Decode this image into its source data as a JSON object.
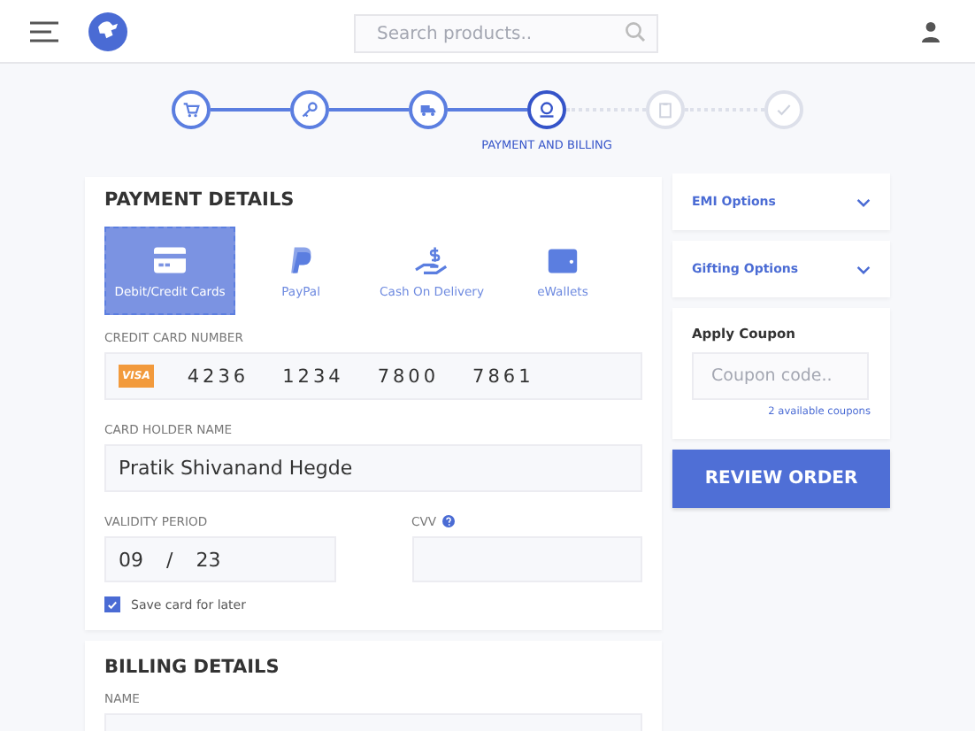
{
  "header": {
    "search": {
      "placeholder": "Search products.."
    }
  },
  "stepper": {
    "steps": [
      {
        "completed": true,
        "selected": false
      },
      {
        "completed": true,
        "selected": false
      },
      {
        "completed": true,
        "selected": false
      },
      {
        "completed": false,
        "selected": true,
        "label": "PAYMENT AND BILLING"
      },
      {
        "completed": false,
        "selected": false
      },
      {
        "completed": false,
        "selected": false
      }
    ]
  },
  "payment_details": {
    "title": "PAYMENT DETAILS",
    "methods": [
      {
        "label": "Debit/Credit Cards",
        "selected": true
      },
      {
        "label": "PayPal",
        "selected": false
      },
      {
        "label": "Cash On Delivery",
        "selected": false
      },
      {
        "label": "eWallets",
        "selected": false
      }
    ],
    "card_number": {
      "label": "CREDIT CARD NUMBER",
      "brand": "VISA",
      "groups": [
        "4236",
        "1234",
        "7800",
        "7861"
      ]
    },
    "card_holder": {
      "label": "CARD HOLDER NAME",
      "value": "Pratik Shivanand Hegde"
    },
    "validity": {
      "label": "VALIDITY PERIOD",
      "month": "09",
      "separator": "/",
      "year": "23"
    },
    "cvv": {
      "label": "CVV"
    },
    "save_card": {
      "label": "Save card for later",
      "checked": true
    }
  },
  "billing_details": {
    "title": "BILLING DETAILS",
    "fields": [
      {
        "label": "NAME"
      }
    ]
  },
  "sidebar": {
    "accordions": [
      {
        "label": "EMI Options",
        "expanded": false
      },
      {
        "label": "Gifting Options",
        "expanded": false
      }
    ],
    "coupon": {
      "title": "Apply Coupon",
      "placeholder": "Coupon code..",
      "link": "2 available coupons"
    },
    "button": "REVIEW ORDER"
  }
}
